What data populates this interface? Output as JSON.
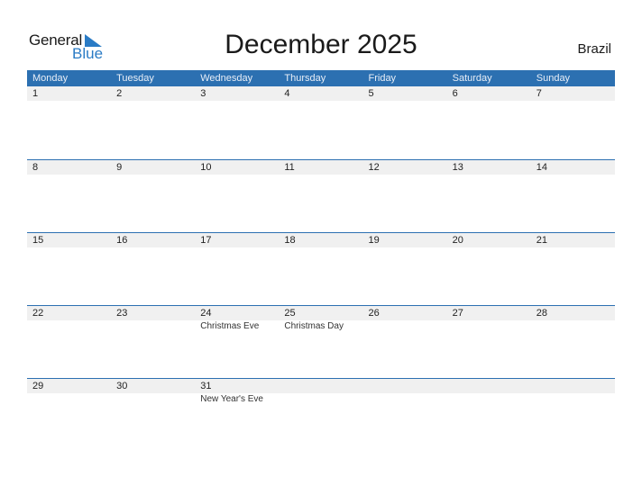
{
  "logo": {
    "general": "General",
    "blue": "Blue",
    "accent_color": "#2a7bc5"
  },
  "header": {
    "title": "December 2025",
    "country": "Brazil"
  },
  "colors": {
    "header_bg": "#2c70b1",
    "date_band_bg": "#f0f0f0"
  },
  "weekdays": [
    "Monday",
    "Tuesday",
    "Wednesday",
    "Thursday",
    "Friday",
    "Saturday",
    "Sunday"
  ],
  "weeks": [
    [
      {
        "day": "1",
        "holiday": ""
      },
      {
        "day": "2",
        "holiday": ""
      },
      {
        "day": "3",
        "holiday": ""
      },
      {
        "day": "4",
        "holiday": ""
      },
      {
        "day": "5",
        "holiday": ""
      },
      {
        "day": "6",
        "holiday": ""
      },
      {
        "day": "7",
        "holiday": ""
      }
    ],
    [
      {
        "day": "8",
        "holiday": ""
      },
      {
        "day": "9",
        "holiday": ""
      },
      {
        "day": "10",
        "holiday": ""
      },
      {
        "day": "11",
        "holiday": ""
      },
      {
        "day": "12",
        "holiday": ""
      },
      {
        "day": "13",
        "holiday": ""
      },
      {
        "day": "14",
        "holiday": ""
      }
    ],
    [
      {
        "day": "15",
        "holiday": ""
      },
      {
        "day": "16",
        "holiday": ""
      },
      {
        "day": "17",
        "holiday": ""
      },
      {
        "day": "18",
        "holiday": ""
      },
      {
        "day": "19",
        "holiday": ""
      },
      {
        "day": "20",
        "holiday": ""
      },
      {
        "day": "21",
        "holiday": ""
      }
    ],
    [
      {
        "day": "22",
        "holiday": ""
      },
      {
        "day": "23",
        "holiday": ""
      },
      {
        "day": "24",
        "holiday": "Christmas Eve"
      },
      {
        "day": "25",
        "holiday": "Christmas Day"
      },
      {
        "day": "26",
        "holiday": ""
      },
      {
        "day": "27",
        "holiday": ""
      },
      {
        "day": "28",
        "holiday": ""
      }
    ],
    [
      {
        "day": "29",
        "holiday": ""
      },
      {
        "day": "30",
        "holiday": ""
      },
      {
        "day": "31",
        "holiday": "New Year's Eve"
      },
      {
        "day": "",
        "holiday": ""
      },
      {
        "day": "",
        "holiday": ""
      },
      {
        "day": "",
        "holiday": ""
      },
      {
        "day": "",
        "holiday": ""
      }
    ]
  ]
}
